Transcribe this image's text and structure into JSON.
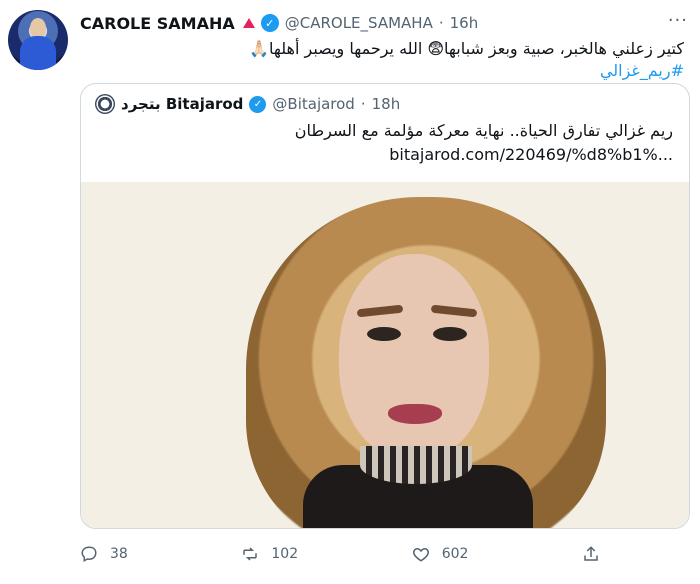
{
  "tweet": {
    "display_name": "CAROLE SAMAHA",
    "handle": "@CAROLE_SAMAHA",
    "separator": "·",
    "time": "16h",
    "text_main": "كتير زعلني هالخبر، صبية وبعز شبابها😨 الله يرحمها ويصبر أهلها🙏🏻",
    "hashtag": "#ريم_غزالي"
  },
  "quoted_tweet": {
    "display_name": "بتجرد Bitajarod",
    "handle": "@Bitajarod",
    "separator": "·",
    "time": "18h",
    "text": "ريم غزالي تفارق الحياة.. نهاية معركة مؤلمة مع السرطان",
    "link": "bitajarod.com/220469/%d8%b1%..."
  },
  "actions": {
    "replies": "38",
    "retweets": "102",
    "likes": "602"
  },
  "colors": {
    "accent": "#1d9bf0",
    "text": "#0f1419",
    "muted": "#536471",
    "border": "#cfd9de",
    "badge": "#e0245e"
  },
  "icons": [
    "reply-icon",
    "retweet-icon",
    "like-icon",
    "share-icon",
    "verified-icon",
    "more-icon"
  ]
}
